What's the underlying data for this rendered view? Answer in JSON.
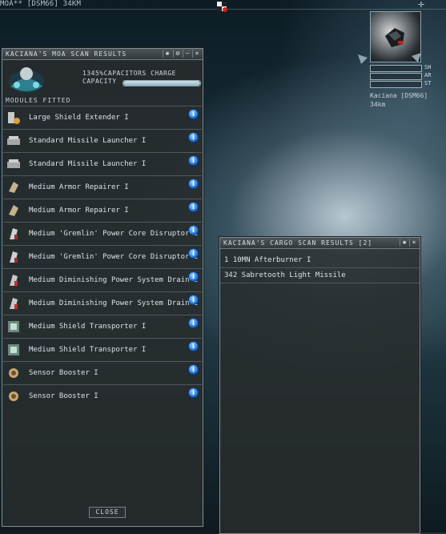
{
  "hud": {
    "top_info": "MOA** [DSM66] 34KM",
    "target": {
      "name": "Kaciana [DSM66]",
      "distance": "34km",
      "bars": [
        {
          "label": "SH",
          "level": 0.0
        },
        {
          "label": "AR",
          "level": 0.0
        },
        {
          "label": "ST",
          "level": 0.0
        }
      ]
    }
  },
  "modules_window": {
    "title": "KACIANA'S MOA SCAN RESULTS",
    "title_buttons": [
      "✱",
      "⚙",
      "–",
      "×"
    ],
    "capacitor_label_1": "1345%CAPACITORS CHARGE",
    "capacitor_label_2": "CAPACITY",
    "capacitor_level": 1.0,
    "modules_fitted_label": "MODULES FITTED",
    "info_glyph": "i",
    "modules": [
      {
        "label": "Large Shield Extender I",
        "icon": "shield-extender-icon"
      },
      {
        "label": "Standard Missile Launcher I",
        "icon": "missile-launcher-icon"
      },
      {
        "label": "Standard Missile Launcher I",
        "icon": "missile-launcher-icon"
      },
      {
        "label": "Medium Armor Repairer I",
        "icon": "armor-repairer-icon"
      },
      {
        "label": "Medium Armor Repairer I",
        "icon": "armor-repairer-icon"
      },
      {
        "label": "Medium 'Gremlin' Power Core Disruptor I",
        "icon": "power-disruptor-icon"
      },
      {
        "label": "Medium 'Gremlin' Power Core Disruptor I",
        "icon": "power-disruptor-icon"
      },
      {
        "label": "Medium Diminishing Power System Drain I",
        "icon": "power-drain-icon"
      },
      {
        "label": "Medium Diminishing Power System Drain I",
        "icon": "power-drain-icon"
      },
      {
        "label": "Medium Shield Transporter I",
        "icon": "shield-transporter-icon"
      },
      {
        "label": "Medium Shield Transporter I",
        "icon": "shield-transporter-icon"
      },
      {
        "label": "Sensor Booster I",
        "icon": "sensor-booster-icon"
      },
      {
        "label": "Sensor Booster I",
        "icon": "sensor-booster-icon"
      }
    ],
    "close_label": "CLOSE"
  },
  "cargo_window": {
    "title": "KACIANA'S CARGO SCAN RESULTS [2]",
    "title_buttons": [
      "✱",
      "×"
    ],
    "items": [
      "1 10MN Afterburner I",
      "342 Sabretooth Light Missile"
    ]
  }
}
